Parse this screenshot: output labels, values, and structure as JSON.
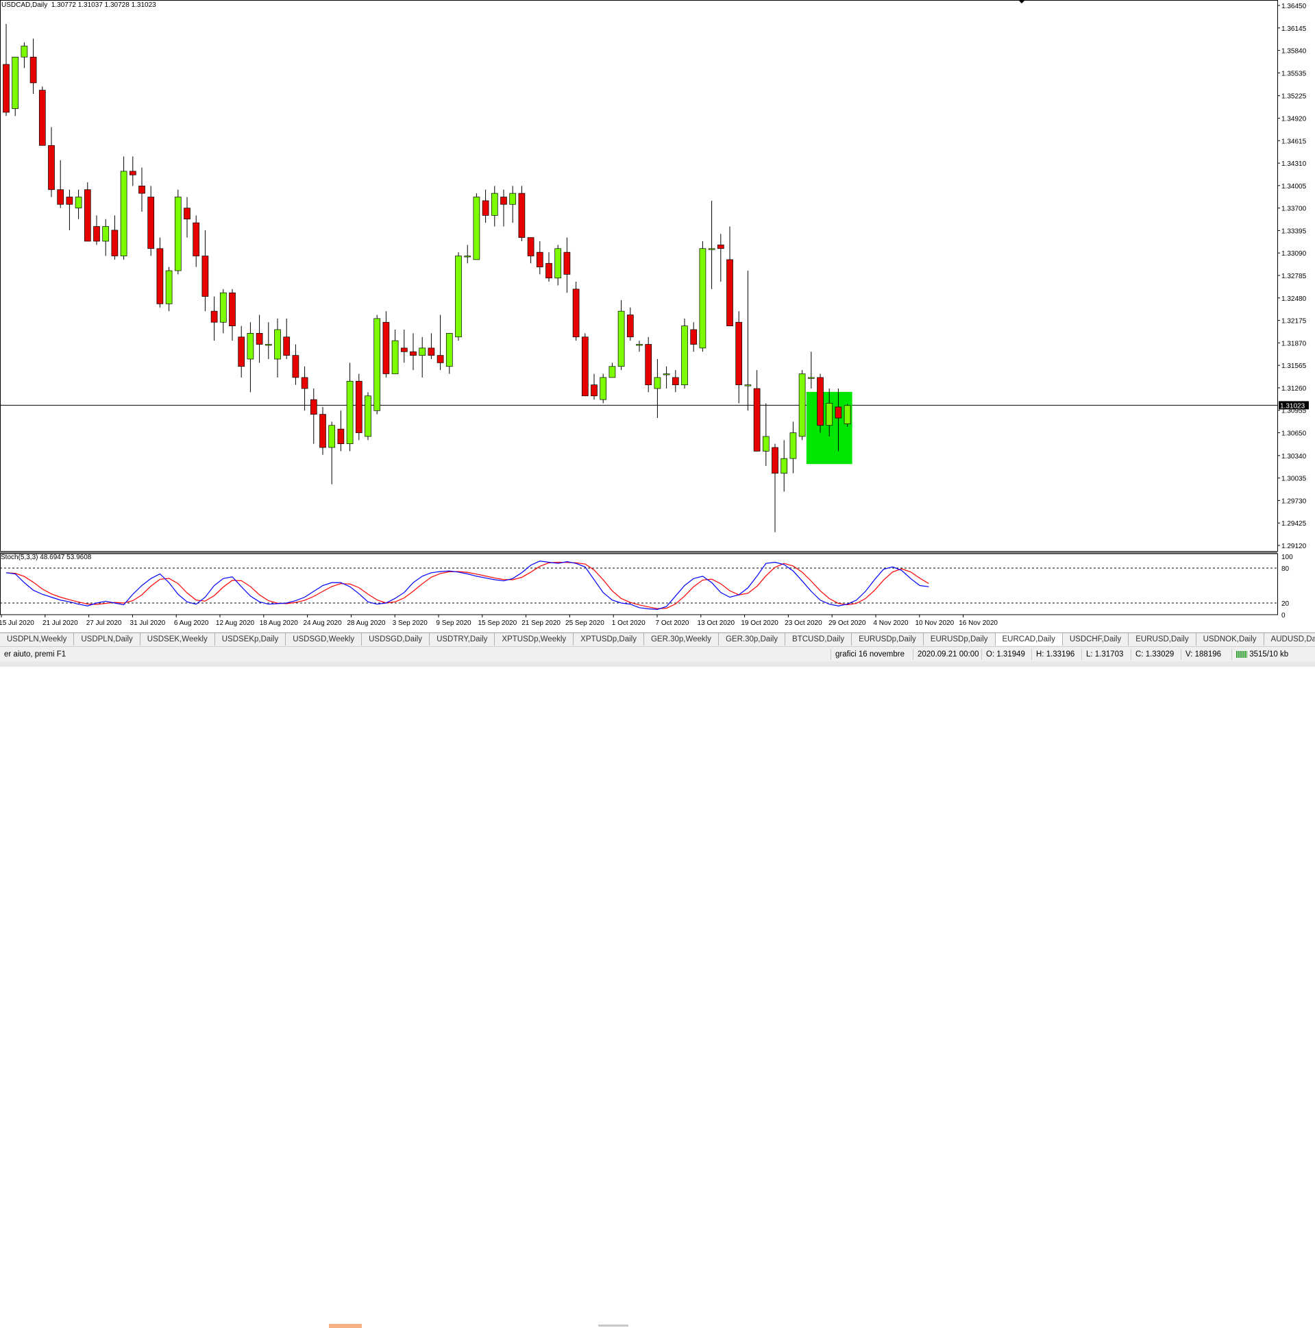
{
  "chart_info": "USDCAD,Daily  1.30772 1.31037 1.30728 1.31023",
  "stoch_info": "Stoch(5,3,3) 48.6947 53.9608",
  "current_price_label": "1.31023",
  "colors": {
    "bull": "#7cfc00",
    "bear": "#e60000",
    "grid": "#000000",
    "stoch_main": "#0000ff",
    "stoch_signal": "#ff0000",
    "highlight": "#00e600"
  },
  "chart_data": {
    "type": "candlestick",
    "symbol": "USDCAD",
    "timeframe": "Daily",
    "ylim": [
      1.2912,
      1.3645
    ],
    "price_ticks": [
      "1.36450",
      "1.36145",
      "1.35840",
      "1.35535",
      "1.35225",
      "1.34920",
      "1.34615",
      "1.34310",
      "1.34005",
      "1.33700",
      "1.33395",
      "1.33090",
      "1.32785",
      "1.32480",
      "1.32175",
      "1.31870",
      "1.31565",
      "1.31260",
      "1.30955",
      "1.30650",
      "1.30340",
      "1.30035",
      "1.29730",
      "1.29425",
      "1.29120"
    ],
    "date_ticks": [
      "15 Jul 2020",
      "21 Jul 2020",
      "27 Jul 2020",
      "31 Jul 2020",
      "6 Aug 2020",
      "12 Aug 2020",
      "18 Aug 2020",
      "24 Aug 2020",
      "28 Aug 2020",
      "3 Sep 2020",
      "9 Sep 2020",
      "15 Sep 2020",
      "21 Sep 2020",
      "25 Sep 2020",
      "1 Oct 2020",
      "7 Oct 2020",
      "13 Oct 2020",
      "19 Oct 2020",
      "23 Oct 2020",
      "29 Oct 2020",
      "4 Nov 2020",
      "10 Nov 2020",
      "16 Nov 2020"
    ],
    "horizontal_line": 1.31023,
    "candles": [
      [
        1.3565,
        1.362,
        1.3495,
        1.35
      ],
      [
        1.3505,
        1.3575,
        1.3495,
        1.3575
      ],
      [
        1.3575,
        1.3595,
        1.356,
        1.359
      ],
      [
        1.3575,
        1.36,
        1.3525,
        1.354
      ],
      [
        1.353,
        1.3535,
        1.3455,
        1.3455
      ],
      [
        1.3455,
        1.348,
        1.3385,
        1.3395
      ],
      [
        1.3395,
        1.3435,
        1.337,
        1.3375
      ],
      [
        1.3385,
        1.3395,
        1.334,
        1.3375
      ],
      [
        1.337,
        1.3395,
        1.3355,
        1.3385
      ],
      [
        1.3395,
        1.3405,
        1.3335,
        1.3325
      ],
      [
        1.3345,
        1.336,
        1.332,
        1.3325
      ],
      [
        1.3325,
        1.3355,
        1.3305,
        1.3345
      ],
      [
        1.334,
        1.336,
        1.33,
        1.3305
      ],
      [
        1.3305,
        1.344,
        1.33,
        1.342
      ],
      [
        1.342,
        1.344,
        1.34,
        1.3415
      ],
      [
        1.34,
        1.3425,
        1.3365,
        1.339
      ],
      [
        1.3385,
        1.34,
        1.3305,
        1.3315
      ],
      [
        1.3315,
        1.333,
        1.3235,
        1.324
      ],
      [
        1.324,
        1.329,
        1.323,
        1.3285
      ],
      [
        1.3285,
        1.3395,
        1.328,
        1.3385
      ],
      [
        1.337,
        1.3385,
        1.333,
        1.3355
      ],
      [
        1.335,
        1.336,
        1.329,
        1.3305
      ],
      [
        1.3305,
        1.334,
        1.323,
        1.325
      ],
      [
        1.323,
        1.325,
        1.319,
        1.3215
      ],
      [
        1.3215,
        1.326,
        1.32,
        1.3255
      ],
      [
        1.3255,
        1.326,
        1.319,
        1.321
      ],
      [
        1.3195,
        1.321,
        1.314,
        1.3155
      ],
      [
        1.3165,
        1.3215,
        1.312,
        1.32
      ],
      [
        1.32,
        1.3225,
        1.316,
        1.3185
      ],
      [
        1.3185,
        1.3215,
        1.3165,
        1.3185
      ],
      [
        1.3165,
        1.322,
        1.314,
        1.3205
      ],
      [
        1.3195,
        1.322,
        1.3165,
        1.317
      ],
      [
        1.317,
        1.3185,
        1.313,
        1.314
      ],
      [
        1.314,
        1.3155,
        1.3095,
        1.3125
      ],
      [
        1.311,
        1.3125,
        1.305,
        1.309
      ],
      [
        1.309,
        1.31,
        1.3035,
        1.3045
      ],
      [
        1.3045,
        1.308,
        1.2995,
        1.3075
      ],
      [
        1.307,
        1.3095,
        1.304,
        1.305
      ],
      [
        1.305,
        1.316,
        1.304,
        1.3135
      ],
      [
        1.3135,
        1.3145,
        1.3055,
        1.3065
      ],
      [
        1.306,
        1.312,
        1.3055,
        1.3115
      ],
      [
        1.3095,
        1.3225,
        1.309,
        1.322
      ],
      [
        1.3215,
        1.323,
        1.314,
        1.3145
      ],
      [
        1.3145,
        1.3205,
        1.3145,
        1.319
      ],
      [
        1.318,
        1.3205,
        1.316,
        1.3175
      ],
      [
        1.3175,
        1.32,
        1.315,
        1.317
      ],
      [
        1.317,
        1.3195,
        1.314,
        1.318
      ],
      [
        1.318,
        1.32,
        1.3165,
        1.317
      ],
      [
        1.317,
        1.3225,
        1.315,
        1.316
      ],
      [
        1.3155,
        1.3195,
        1.3145,
        1.32
      ],
      [
        1.3195,
        1.331,
        1.319,
        1.3305
      ],
      [
        1.3305,
        1.332,
        1.3295,
        1.3305
      ],
      [
        1.33,
        1.339,
        1.33,
        1.3385
      ],
      [
        1.338,
        1.3395,
        1.335,
        1.336
      ],
      [
        1.336,
        1.34,
        1.3345,
        1.339
      ],
      [
        1.3385,
        1.3395,
        1.3345,
        1.3375
      ],
      [
        1.3375,
        1.34,
        1.335,
        1.339
      ],
      [
        1.339,
        1.34,
        1.3325,
        1.333
      ],
      [
        1.333,
        1.3325,
        1.3295,
        1.3305
      ],
      [
        1.331,
        1.3325,
        1.328,
        1.329
      ],
      [
        1.3295,
        1.331,
        1.327,
        1.3275
      ],
      [
        1.3275,
        1.332,
        1.3265,
        1.3315
      ],
      [
        1.331,
        1.333,
        1.3255,
        1.328
      ],
      [
        1.326,
        1.327,
        1.319,
        1.3195
      ],
      [
        1.3195,
        1.32,
        1.312,
        1.3115
      ],
      [
        1.313,
        1.3145,
        1.311,
        1.3115
      ],
      [
        1.311,
        1.3145,
        1.3105,
        1.314
      ],
      [
        1.314,
        1.316,
        1.314,
        1.3155
      ],
      [
        1.3155,
        1.3245,
        1.315,
        1.323
      ],
      [
        1.3225,
        1.3235,
        1.319,
        1.3195
      ],
      [
        1.3185,
        1.319,
        1.3175,
        1.3185
      ],
      [
        1.3185,
        1.3195,
        1.312,
        1.313
      ],
      [
        1.3125,
        1.3165,
        1.3085,
        1.314
      ],
      [
        1.3145,
        1.3155,
        1.3125,
        1.3145
      ],
      [
        1.314,
        1.315,
        1.312,
        1.313
      ],
      [
        1.313,
        1.322,
        1.3125,
        1.321
      ],
      [
        1.3205,
        1.3215,
        1.3175,
        1.3185
      ],
      [
        1.318,
        1.3325,
        1.3175,
        1.3315
      ],
      [
        1.3315,
        1.338,
        1.326,
        1.3315
      ],
      [
        1.332,
        1.3335,
        1.327,
        1.3315
      ],
      [
        1.33,
        1.3345,
        1.3215,
        1.321
      ],
      [
        1.3215,
        1.323,
        1.3105,
        1.313
      ],
      [
        1.313,
        1.3285,
        1.3095,
        1.313
      ],
      [
        1.3125,
        1.315,
        1.3075,
        1.304
      ],
      [
        1.304,
        1.3105,
        1.302,
        1.306
      ],
      [
        1.3045,
        1.305,
        1.293,
        1.301
      ],
      [
        1.301,
        1.3055,
        1.2985,
        1.303
      ],
      [
        1.303,
        1.308,
        1.301,
        1.3065
      ],
      [
        1.306,
        1.315,
        1.3055,
        1.3145
      ],
      [
        1.314,
        1.3175,
        1.3125,
        1.314
      ],
      [
        1.314,
        1.3145,
        1.3065,
        1.3075
      ],
      [
        1.3075,
        1.3125,
        1.306,
        1.3105
      ],
      [
        1.31,
        1.3125,
        1.304,
        1.3085
      ],
      [
        1.3077,
        1.3104,
        1.3073,
        1.3102
      ]
    ],
    "highlight_box": {
      "price_top": 1.31205,
      "price_bottom": 1.30225,
      "from_candle": 89,
      "to_candle": 93
    },
    "stochastic": {
      "levels": [
        100,
        80,
        20,
        0
      ],
      "main": [
        72,
        70,
        55,
        42,
        35,
        30,
        25,
        22,
        18,
        15,
        20,
        23,
        20,
        17,
        35,
        50,
        62,
        70,
        55,
        35,
        22,
        18,
        30,
        50,
        62,
        65,
        48,
        32,
        22,
        18,
        19,
        20,
        24,
        30,
        40,
        50,
        55,
        55,
        48,
        36,
        22,
        18,
        20,
        28,
        38,
        55,
        66,
        72,
        74,
        75,
        73,
        70,
        66,
        63,
        60,
        58,
        62,
        72,
        85,
        92,
        90,
        88,
        91,
        88,
        82,
        60,
        38,
        25,
        20,
        18,
        12,
        10,
        9,
        14,
        32,
        50,
        62,
        66,
        55,
        38,
        30,
        34,
        46,
        66,
        88,
        90,
        86,
        75,
        58,
        40,
        25,
        18,
        15,
        18,
        25,
        40,
        60,
        78,
        82,
        76,
        62,
        50,
        48
      ]
    }
  },
  "symbol_tabs": [
    "USDPLN,Weekly",
    "USDPLN,Daily",
    "USDSEK,Weekly",
    "USDSEKp,Daily",
    "USDSGD,Weekly",
    "USDSGD,Daily",
    "USDTRY,Daily",
    "XPTUSDp,Weekly",
    "XPTUSDp,Daily",
    "GER.30p,Weekly",
    "GER.30p,Daily",
    "BTCUSD,Daily",
    "EURUSDp,Daily",
    "EURUSDp,Daily",
    "EURCAD,Daily",
    "USDCHF,Daily",
    "EURUSD,Daily",
    "USDNOK,Daily",
    "AUDUSD,Da"
  ],
  "active_tab": 14,
  "status_bar": {
    "help": "er aiuto, premi F1",
    "profile": "grafici 16 novembre",
    "datetime": "2020.09.21 00:00",
    "open": "O: 1.31949",
    "high": "H: 1.33196",
    "low": "L: 1.31703",
    "close": "C: 1.33029",
    "volume": "V: 188196",
    "traffic": "3515/10 kb"
  }
}
